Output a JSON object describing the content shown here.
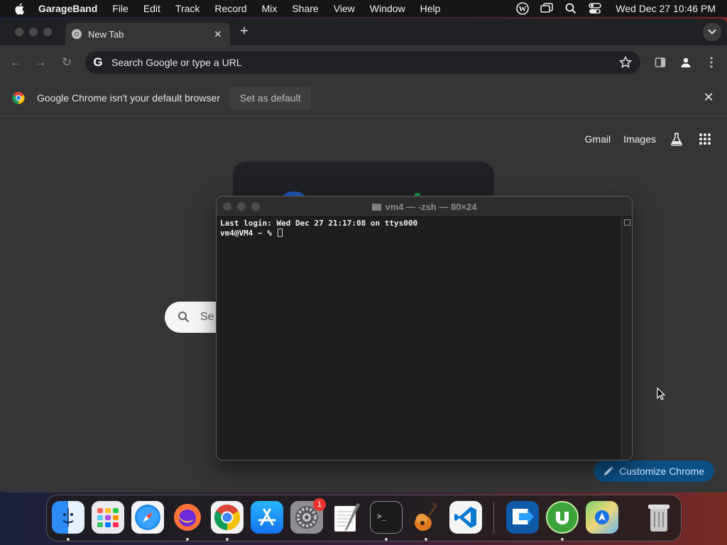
{
  "menubar": {
    "app_name": "GarageBand",
    "items": [
      "File",
      "Edit",
      "Track",
      "Record",
      "Mix",
      "Share",
      "View",
      "Window",
      "Help"
    ],
    "clock": "Wed Dec 27  10:46 PM",
    "status_icons": [
      "wordpress-icon",
      "screen-mirroring-icon",
      "spotlight-search-icon",
      "control-center-icon"
    ]
  },
  "chrome": {
    "tab_title": "New Tab",
    "omnibox_placeholder": "Search Google or type a URL",
    "infobar_message": "Google Chrome isn't your default browser",
    "infobar_button": "Set as default",
    "ntp_links": [
      "Gmail",
      "Images"
    ],
    "search_placeholder_partial": "Se",
    "customize_label": "Customize Chrome"
  },
  "terminal": {
    "title": "vm4 — -zsh — 80×24",
    "lines": [
      "Last login: Wed Dec 27 21:17:08 on ttys000",
      "vm4@VM4 ~ % "
    ]
  },
  "dock": {
    "apps": [
      "Finder",
      "Launchpad",
      "Safari",
      "Firefox",
      "Google Chrome",
      "App Store",
      "System Settings",
      "TextEdit",
      "Terminal",
      "GarageBand",
      "Visual Studio Code"
    ],
    "apps_after_separator": [
      "Remote Desktop",
      "uTorrent",
      "Maps",
      "Trash"
    ],
    "system_settings_badge": "1"
  },
  "colors": {
    "chrome_bg": "#353535",
    "tabstrip_bg": "#202124",
    "accent_blue": "#0b4f84",
    "badge_red": "#e8332e"
  }
}
